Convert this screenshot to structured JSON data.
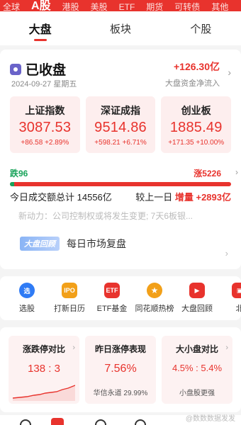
{
  "market_tabs": [
    "全球",
    "A股",
    "港股",
    "美股",
    "ETF",
    "期货",
    "可转债",
    "其他"
  ],
  "sub_tabs": [
    "大盘",
    "板块",
    "个股"
  ],
  "status": {
    "text": "已收盘",
    "date": "2024-09-27 星期五"
  },
  "net_flow": {
    "value": "+126.30亿",
    "label": "大盘资金净流入"
  },
  "indices": [
    {
      "name": "上证指数",
      "price": "3087.53",
      "change": "+86.58",
      "pct": "+2.89%"
    },
    {
      "name": "深证成指",
      "price": "9514.86",
      "change": "+598.21",
      "pct": "+6.71%"
    },
    {
      "name": "创业板",
      "price": "1885.49",
      "change": "+171.35",
      "pct": "+10.00%"
    }
  ],
  "breadth": {
    "fall_label": "跌96",
    "rise_label": "涨5226",
    "fall_fraction": 0.018
  },
  "volume": {
    "total_label": "今日成交额总计",
    "total": "14556亿",
    "compare_label": "较上一日",
    "inc_label": "增量",
    "inc_value": "+2893亿"
  },
  "news": "新动力：公司控制权或将发生变更; 7天6板银...",
  "review": {
    "tag": "大盘回顾",
    "text": "每日市场复盘"
  },
  "tools": [
    {
      "label": "选股",
      "icon": "select-stock-icon",
      "glyph": "选",
      "color": "#2f7bf5"
    },
    {
      "label": "打新日历",
      "icon": "ipo-calendar-icon",
      "glyph": "IPO",
      "color": "#f2a019"
    },
    {
      "label": "ETF基金",
      "icon": "etf-icon",
      "glyph": "ETF",
      "color": "#e8332d"
    },
    {
      "label": "同花顺热榜",
      "icon": "hot-rank-icon",
      "glyph": "★",
      "color": "#f2a019"
    },
    {
      "label": "大盘回顾",
      "icon": "market-review-icon",
      "glyph": "▶",
      "color": "#e8332d"
    },
    {
      "label": "北",
      "icon": "northbound-icon",
      "glyph": "▣",
      "color": "#e8332d"
    }
  ],
  "stats": [
    {
      "title": "涨跌停对比",
      "value": "138 : 3",
      "sub": ""
    },
    {
      "title": "昨日涨停表现",
      "value": "7.56%",
      "sub": "华信永道 29.99%"
    },
    {
      "title": "大小盘对比",
      "value": "4.5% : 5.4%",
      "sub": "小盘股更强"
    }
  ],
  "watermark": "@数数数据发发",
  "colors": {
    "up": "#e8332d",
    "down": "#19a35a",
    "accent": "#e8332d"
  }
}
